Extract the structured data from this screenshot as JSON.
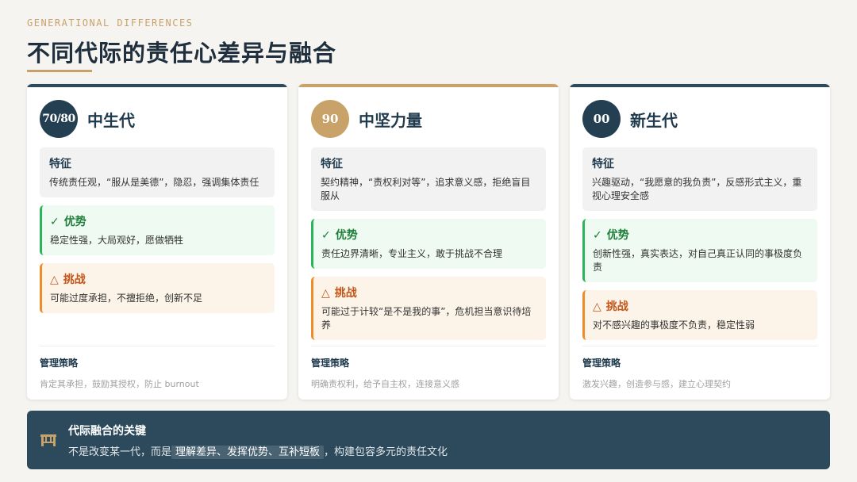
{
  "header": {
    "eyebrow": "GENERATIONAL DIFFERENCES",
    "title": "不同代际的责任心差异与融合"
  },
  "labels": {
    "feature": "特征",
    "advantage": "优势",
    "challenge": "挑战",
    "strategy": "管理策略"
  },
  "icons": {
    "advantage": "✓",
    "challenge": "△"
  },
  "colors": {
    "navy": "#2c4a5c",
    "gold": "#c9a26a",
    "green": "#2bb55a",
    "orange": "#ee8c2a"
  },
  "cards": [
    {
      "badge": "70/80",
      "name": "中生代",
      "feature": "传统责任观，“服从是美德”，隐忍，强调集体责任",
      "advantage": "稳定性强，大局观好，愿做牺牲",
      "challenge": "可能过度承担，不擅拒绝，创新不足",
      "strategy": "肯定其承担，鼓励其授权，防止 burnout"
    },
    {
      "badge": "90",
      "name": "中坚力量",
      "feature": "契约精神，“责权利对等”，追求意义感，拒绝盲目服从",
      "advantage": "责任边界清晰，专业主义，敢于挑战不合理",
      "challenge": "可能过于计较“是不是我的事”，危机担当意识待培养",
      "strategy": "明确责权利，给予自主权，连接意义感"
    },
    {
      "badge": "00",
      "name": "新生代",
      "feature": "兴趣驱动，“我愿意的我负责”，反感形式主义，重视心理安全感",
      "advantage": "创新性强，真实表达，对自己真正认同的事极度负责",
      "challenge": "对不感兴趣的事极度不负责，稳定性弱",
      "strategy": "激发兴趣，创造参与感，建立心理契约"
    }
  ],
  "banner": {
    "icon": "bridge-icon",
    "title": "代际融合的关键",
    "text_before": "不是改变某一代，而是",
    "text_highlight": "理解差异、发挥优势、互补短板",
    "text_after": "，构建包容多元的责任文化"
  }
}
